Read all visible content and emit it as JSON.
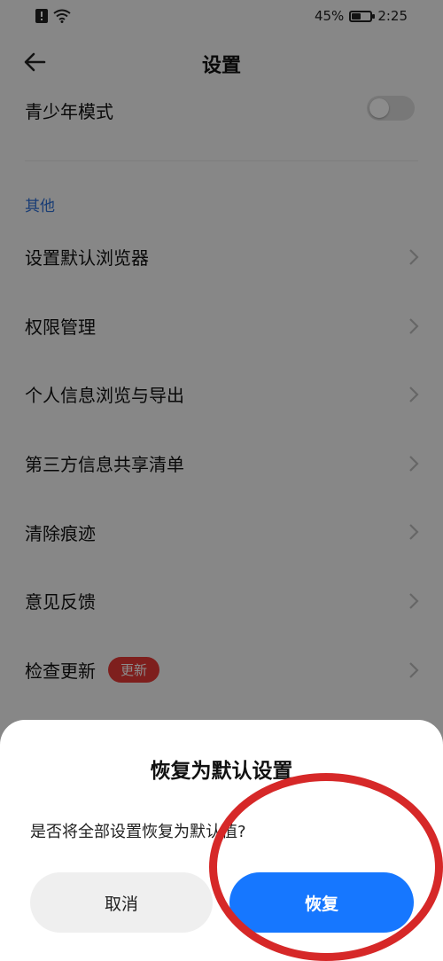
{
  "status_bar": {
    "battery": "45%",
    "battery_level": 0.45,
    "time": "2:25"
  },
  "nav": {
    "title": "设置"
  },
  "teen_mode": {
    "label": "青少年模式",
    "enabled": false
  },
  "section": {
    "header": "其他"
  },
  "menu": [
    {
      "label": "设置默认浏览器"
    },
    {
      "label": "权限管理"
    },
    {
      "label": "个人信息浏览与导出"
    },
    {
      "label": "第三方信息共享清单"
    },
    {
      "label": "清除痕迹"
    },
    {
      "label": "意见反馈"
    },
    {
      "label": "检查更新",
      "badge": "更新"
    }
  ],
  "dialog": {
    "title": "恢复为默认设置",
    "message": "是否将全部设置恢复为默认值?",
    "cancel_label": "取消",
    "confirm_label": "恢复"
  },
  "colors": {
    "accent": "#1677ff",
    "section_header": "#2f6fd6",
    "badge": "#e53935",
    "annotation": "#d62828"
  }
}
